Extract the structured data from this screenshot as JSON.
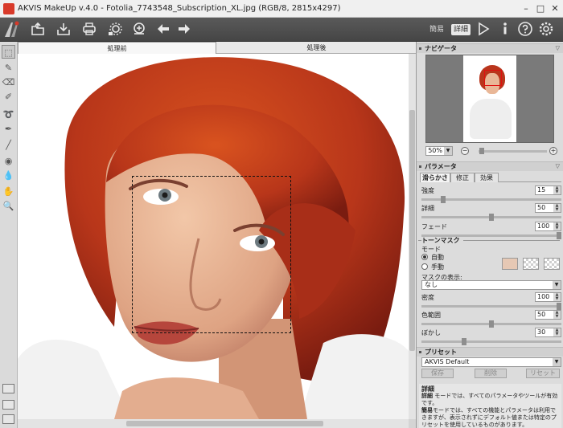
{
  "window": {
    "title": "AKVIS MakeUp v.4.0 - Fotolia_7743548_Subscription_XL.jpg (RGB/8, 2815x4297)",
    "minimize": "–",
    "maximize": "□",
    "close": "✕"
  },
  "toolbar": {
    "mode_simple": "簡易",
    "mode_advanced": "詳細",
    "icons": [
      "open-icon",
      "save-icon",
      "print-icon",
      "batch-settings-icon",
      "share-icon",
      "back-arrow-icon",
      "forward-arrow-icon",
      "run-icon",
      "info-icon",
      "help-icon",
      "gear-icon"
    ]
  },
  "tools": [
    "selection-tool-icon",
    "brush-tool-icon",
    "eraser-tool-icon",
    "pencil-tool-icon",
    "lasso-tool-icon",
    "paint-tool-icon",
    "line-tool-icon",
    "eye-tool-icon",
    "drop-tool-icon",
    "hand-tool-icon",
    "zoom-tool-icon"
  ],
  "canvas": {
    "tab_before": "処理前",
    "tab_after": "処理後"
  },
  "navigator": {
    "title": "ナビゲータ",
    "zoom": "50%",
    "zoom_out": "−",
    "zoom_in": "+"
  },
  "params": {
    "title": "パラメータ",
    "tabs": [
      "滑らかさ",
      "修正",
      "効果"
    ],
    "strength_label": "強度",
    "strength_value": "15",
    "detail_label": "詳細",
    "detail_value": "50",
    "fade_label": "フェード",
    "fade_value": "100"
  },
  "tone_mask": {
    "title": "トーンマスク",
    "mode_label": "モード",
    "mode_auto": "自動",
    "mode_manual": "手動",
    "mask_display_label": "マスクの表示:",
    "mask_display_value": "なし",
    "density_label": "密度",
    "density_value": "100",
    "color_range_label": "色範囲",
    "color_range_value": "50",
    "blur_label": "ぼかし",
    "blur_value": "30",
    "swatch_color": "#e6c8b4"
  },
  "presets": {
    "title": "プリセット",
    "current": "AKVIS Default",
    "save": "保存",
    "delete": "削除",
    "reset": "リセット"
  },
  "help": {
    "title": "詳細",
    "line1_bold": "詳細",
    "line1": " モードでは、すべてのパラメータやツールが有効です。",
    "line2_bold": "簡易",
    "line2": "モードでは、すべての機能とパラメータは利用できますが、表示されずにデフォルト値または特定のプリセットを使用しているものがあります。"
  }
}
